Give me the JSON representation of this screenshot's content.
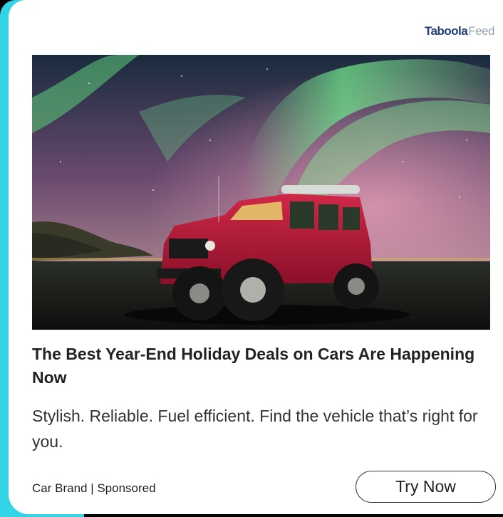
{
  "brand": {
    "logo_bold": "Taboola",
    "logo_light": "Feed"
  },
  "ad": {
    "image_alt": "",
    "headline": "The Best Year-End Holiday Deals on Cars Are Happening Now",
    "description": "Stylish. Reliable. Fuel efficient. Find the vehicle that’s right for you.",
    "advertiser": "Car Brand | Sponsored",
    "cta_label": "Try Now"
  },
  "colors": {
    "accent_cyan": "#33d4e6",
    "vehicle_red": "#c0193a",
    "aurora_green": "#6fe08a"
  }
}
